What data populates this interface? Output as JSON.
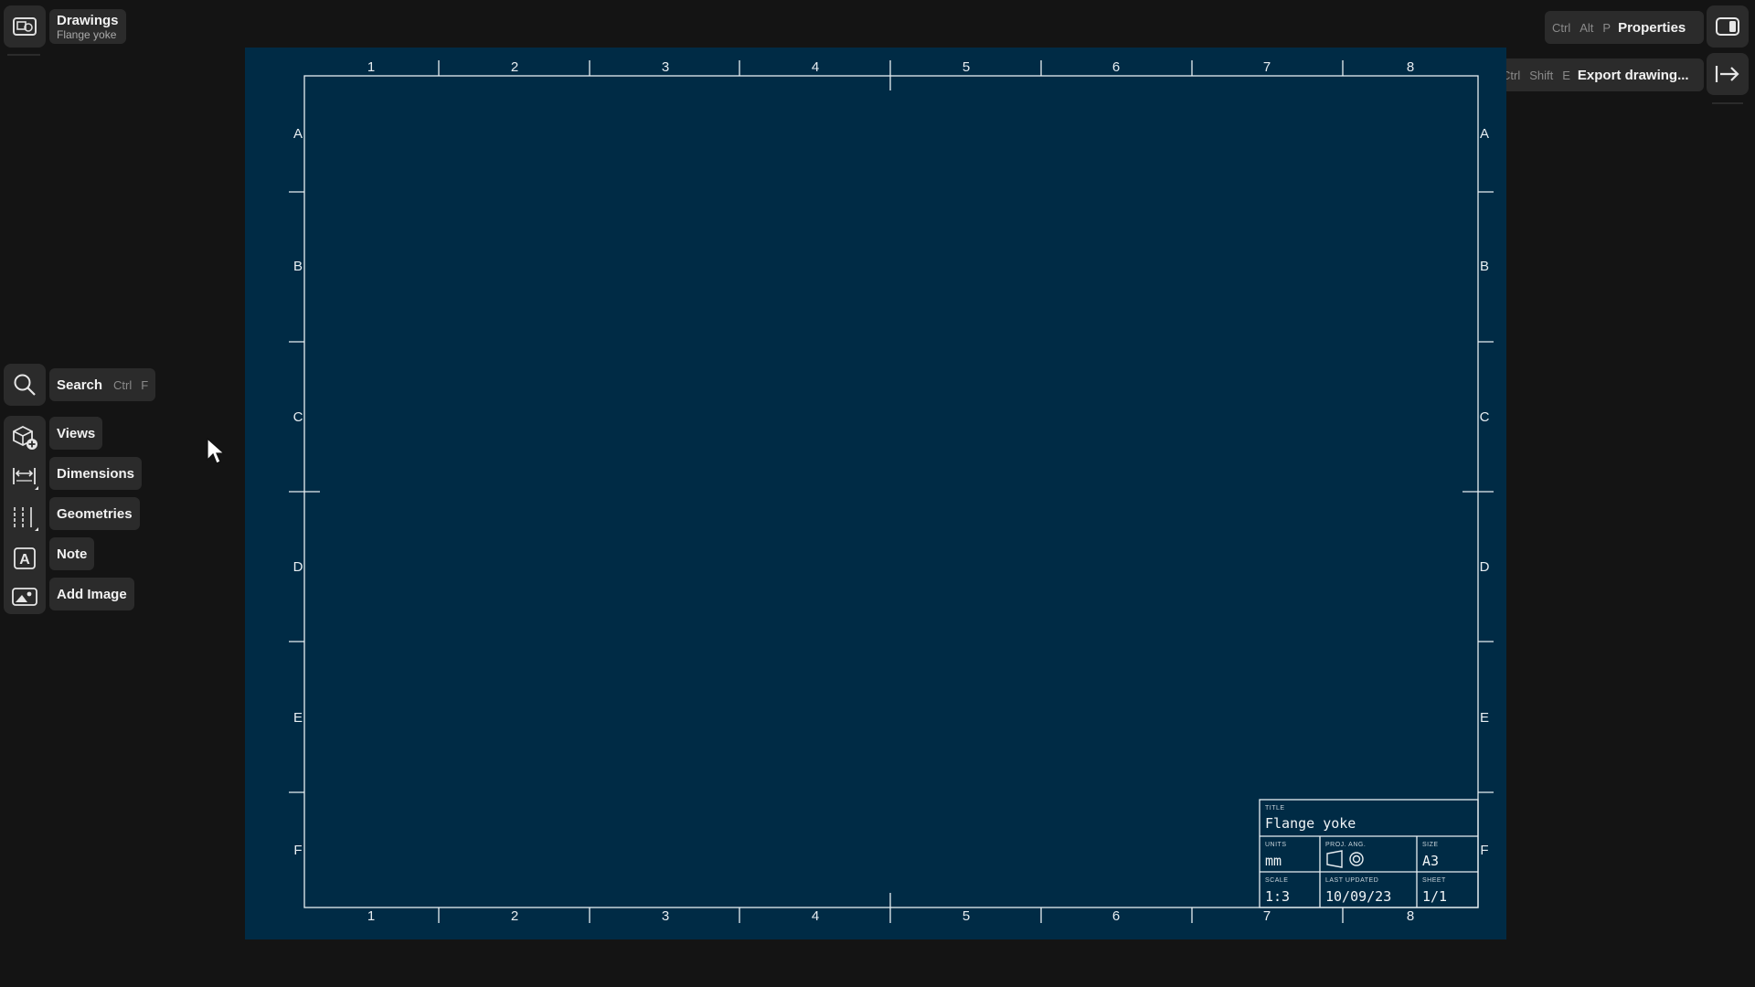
{
  "header": {
    "app_title": "Drawings",
    "document_name": "Flange yoke",
    "app_icon": "drawing-icon"
  },
  "top_right": {
    "properties": {
      "keys": [
        "Ctrl",
        "Alt",
        "P"
      ],
      "label": "Properties",
      "icon": "panel-icon"
    },
    "export": {
      "keys": [
        "Ctrl",
        "Shift",
        "E"
      ],
      "label": "Export drawing...",
      "icon": "export-arrow-icon"
    }
  },
  "search": {
    "label": "Search",
    "keys": [
      "Ctrl",
      "F"
    ],
    "icon": "search-icon"
  },
  "tools": [
    {
      "label": "Views",
      "icon": "views-add-icon"
    },
    {
      "label": "Dimensions",
      "icon": "dimension-icon"
    },
    {
      "label": "Geometries",
      "icon": "geometries-icon"
    },
    {
      "label": "Note",
      "icon": "note-text-icon"
    },
    {
      "label": "Add Image",
      "icon": "image-icon"
    }
  ],
  "sheet": {
    "columns": [
      "1",
      "2",
      "3",
      "4",
      "5",
      "6",
      "7",
      "8"
    ],
    "rows": [
      "A",
      "B",
      "C",
      "D",
      "E",
      "F"
    ],
    "colors": {
      "background": "#002b45",
      "lines": "#e8eef2"
    }
  },
  "title_block": {
    "title_label": "TITLE",
    "title": "Flange yoke",
    "units_label": "UNITS",
    "units": "mm",
    "projection_label": "PROJ. ANG.",
    "size_label": "SIZE",
    "size": "A3",
    "scale_label": "SCALE",
    "scale": "1:3",
    "updated_label": "LAST UPDATED",
    "updated": "10/09/23",
    "sheet_label": "SHEET",
    "sheet": "1/1"
  }
}
